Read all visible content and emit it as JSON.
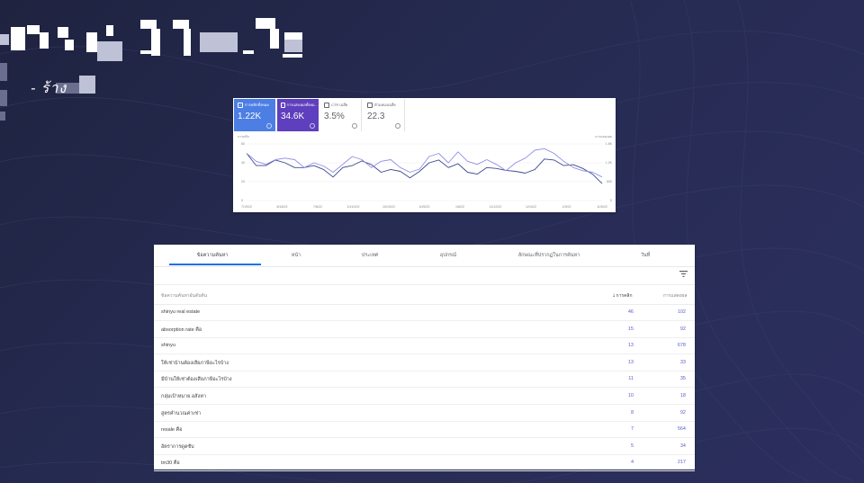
{
  "hero": {
    "title": "",
    "subtitle": "- ร้าง"
  },
  "performance": {
    "metrics": [
      {
        "label": "การคลิกทั้งหมด",
        "value": "1.22K",
        "checked": true
      },
      {
        "label": "การแสดงผลทั้งหม...",
        "value": "34.6K",
        "checked": true
      },
      {
        "label": "CTR เฉลี่ย",
        "value": "3.5%",
        "checked": false
      },
      {
        "label": "ตำแหน่งเฉลี่ย",
        "value": "22.3",
        "checked": false
      }
    ],
    "chart_data": {
      "type": "line",
      "left_axis_label": "การคลิก",
      "right_axis_label": "การแสดงผล",
      "left_ticks": [
        "0",
        "20",
        "40",
        "60"
      ],
      "right_ticks": [
        "0",
        "600",
        "1.2K",
        "1.8K"
      ],
      "ylim_left": [
        0,
        60
      ],
      "ylim_right": [
        0,
        1800
      ],
      "x_ticks": [
        "7/19/22",
        "8/18/22",
        "7/8/22",
        "10/10/22",
        "10/19/22",
        "10/5/22",
        "1/8/22",
        "11/12/22",
        "12/4/22",
        "1/9/22",
        "11/5/22"
      ],
      "series": [
        {
          "name": "การคลิก",
          "color": "#3c4a8c",
          "values": [
            50,
            37,
            37,
            43,
            40,
            35,
            35,
            37,
            33,
            25,
            35,
            37,
            42,
            38,
            30,
            33,
            31,
            24,
            31,
            40,
            43,
            35,
            39,
            30,
            28,
            35,
            34,
            32,
            31,
            29,
            33,
            44,
            43,
            37,
            38,
            34,
            28,
            18
          ]
        },
        {
          "name": "การแสดงผล",
          "color": "#8f8ee8",
          "values": [
            1500,
            1250,
            1150,
            1300,
            1350,
            1300,
            1050,
            1200,
            1100,
            900,
            1150,
            1400,
            1300,
            1050,
            1250,
            1300,
            1050,
            900,
            1000,
            1400,
            1500,
            1200,
            1550,
            1250,
            1150,
            1300,
            1150,
            950,
            1200,
            1350,
            1600,
            1650,
            1500,
            1250,
            1050,
            950,
            900,
            750
          ]
        }
      ]
    }
  },
  "queries": {
    "tabs": [
      "ข้อความค้นหา",
      "หน้า",
      "ประเทศ",
      "อุปกรณ์",
      "ลักษณะที่ปรากฏในการค้นหา",
      "วันที่"
    ],
    "active_tab": 0,
    "columns": {
      "query": "ข้อความค้นหาอันดับต้น",
      "clicks": "การคลิก",
      "impressions": "การแสดงผล"
    },
    "rows": [
      {
        "query": "shinyu real estate",
        "clicks": "46",
        "impressions": "102"
      },
      {
        "query": "absorption rate คือ",
        "clicks": "15",
        "impressions": "92"
      },
      {
        "query": "shinyu",
        "clicks": "13",
        "impressions": "678"
      },
      {
        "query": "ให้เช่าบ้านต้องเสียภาษีอะไรบ้าง",
        "clicks": "13",
        "impressions": "33"
      },
      {
        "query": "มีบ้านให้เช่าต้องเสียภาษีอะไรบ้าง",
        "clicks": "11",
        "impressions": "35"
      },
      {
        "query": "กลุ่มเป้าหมาย อสังหา",
        "clicks": "10",
        "impressions": "18"
      },
      {
        "query": "สูตรคำนวณค่าเช่า",
        "clicks": "8",
        "impressions": "92"
      },
      {
        "query": "resale คือ",
        "clicks": "7",
        "impressions": "564"
      },
      {
        "query": "อัตราการดูดซับ",
        "clicks": "5",
        "impressions": "34"
      },
      {
        "query": "tm30 คือ",
        "clicks": "4",
        "impressions": "217"
      }
    ]
  }
}
